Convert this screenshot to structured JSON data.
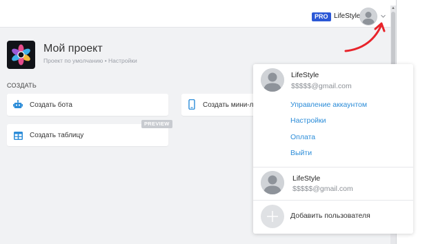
{
  "topbar": {
    "pro_badge": "PRO",
    "username": "LifeStyle"
  },
  "project": {
    "title": "Мой проект",
    "subtitle": "Проект по умолчанию • Настройки"
  },
  "create_section": {
    "label": "СОЗДАТЬ",
    "cards": [
      {
        "label": "Создать бота",
        "icon": "robot-icon"
      },
      {
        "label": "Создать мини-л",
        "icon": "phone-icon"
      },
      {
        "label": "Создать таблицу",
        "icon": "table-icon",
        "badge": "PREVIEW"
      }
    ]
  },
  "dropdown": {
    "current_user": {
      "name": "LifeStyle",
      "email": "$$$$$@gmail.com"
    },
    "links": [
      "Управление аккаунтом",
      "Настройки",
      "Оплата",
      "Выйти"
    ],
    "other_user": {
      "name": "LifeStyle",
      "email": "$$$$$@gmail.com"
    },
    "add_user_label": "Добавить пользователя"
  },
  "colors": {
    "accent_link": "#2b8cd8",
    "pro_badge": "#2b58d6",
    "annotation_arrow": "#e8242b",
    "background": "#f1f2f4"
  }
}
